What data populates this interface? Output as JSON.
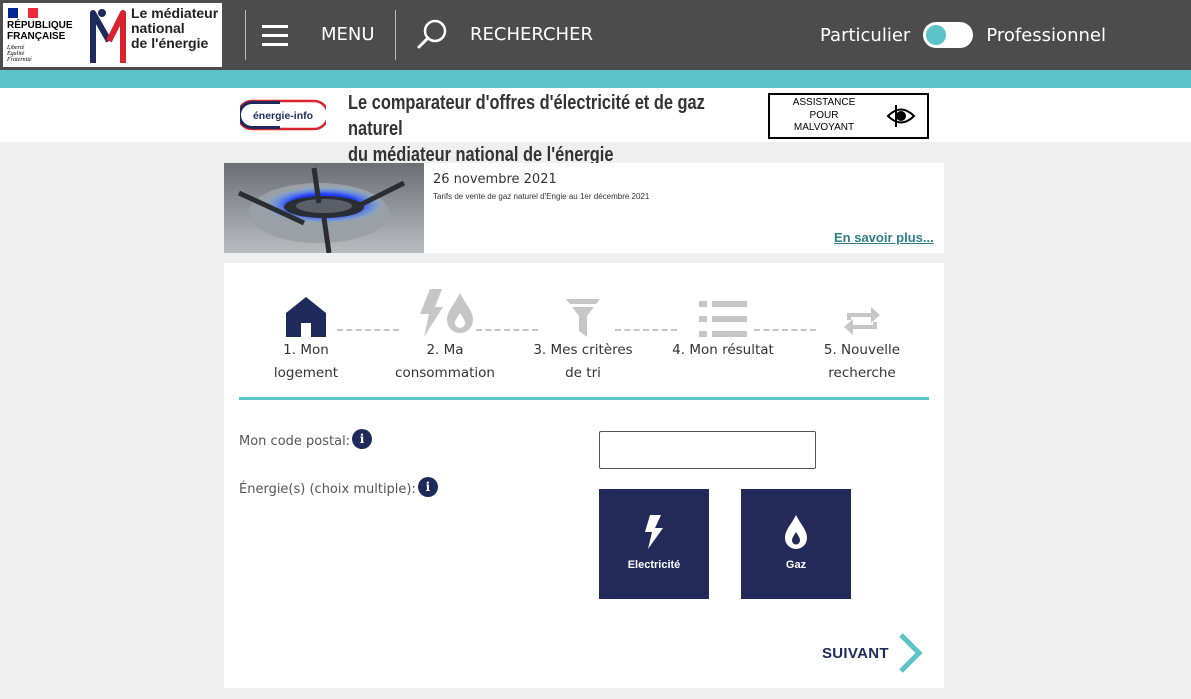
{
  "header": {
    "rf_line1": "RÉPUBLIQUE",
    "rf_line2": "FRANÇAISE",
    "rf_motto1": "Liberté",
    "rf_motto2": "Égalité",
    "rf_motto3": "Fraternité",
    "mediator_line1": "Le médiateur",
    "mediator_line2": "national",
    "mediator_line3": "de l'énergie",
    "menu_label": "MENU",
    "search_label": "RECHERCHER",
    "toggle_left": "Particulier",
    "toggle_right": "Professionnel",
    "toggle_state": "Particulier"
  },
  "banner": {
    "logo_text": "énergie-info",
    "title_line1": "Le comparateur d'offres d'électricité et de gaz naturel",
    "title_line2": "du médiateur national de l'énergie",
    "assist_line1": "ASSISTANCE",
    "assist_line2": "POUR",
    "assist_line3": "MALVOYANT"
  },
  "news": {
    "date": "26 novembre 2021",
    "subtitle": "Tarifs de vente de gaz naturel d'Engie au 1er décembre 2021",
    "link": "En savoir plus..."
  },
  "steps": [
    {
      "line1": "1. Mon",
      "line2": "logement",
      "icon": "home-icon",
      "active": true
    },
    {
      "line1": "2. Ma",
      "line2": "consommation",
      "icon": "energy-icon",
      "active": false
    },
    {
      "line1": "3. Mes critères",
      "line2": "de tri",
      "icon": "filter-icon",
      "active": false
    },
    {
      "line1": "4. Mon résultat",
      "line2": "",
      "icon": "list-icon",
      "active": false
    },
    {
      "line1": "5. Nouvelle",
      "line2": "recherche",
      "icon": "repeat-icon",
      "active": false
    }
  ],
  "form": {
    "postal_label": "Mon code postal:",
    "postal_value": "",
    "energy_label": "Énergie(s) (choix multiple):",
    "info_glyph": "i",
    "energy_options": [
      {
        "label": "Electricité",
        "icon": "lightning-icon"
      },
      {
        "label": "Gaz",
        "icon": "flame-icon"
      }
    ],
    "next_label": "SUIVANT"
  },
  "colors": {
    "topbar": "#4c4c4c",
    "teal": "#5bc3c8",
    "navy": "#222a5a",
    "inactive_icon": "#c6c6c6"
  }
}
